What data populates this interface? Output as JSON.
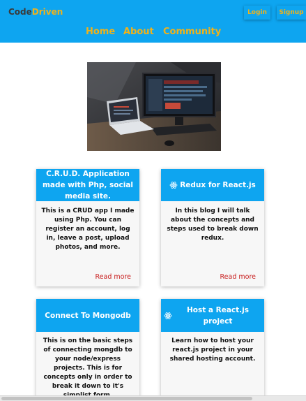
{
  "header": {
    "brand_part1": "Code",
    "brand_part2": "Driven",
    "login_label": "Login",
    "signup_label": "Signup",
    "nav": {
      "home": "Home",
      "about": "About",
      "community": "Community"
    },
    "bg_color": "#0ea5f0",
    "accent_color": "#f0b21a"
  },
  "hero_image": {
    "icon": "laptop-desk-photo"
  },
  "posts": [
    {
      "title": "C.R.U.D. Application made with Php, social media site.",
      "body": "This is a CRUD app I made using Php. You can register an account, log in, leave a post, upload photos, and more.",
      "link": "Read more"
    },
    {
      "icon": "react-icon",
      "title": "Redux for React.js",
      "body": "In this blog I will talk about the concepts and steps used to break down redux.",
      "link": "Read more"
    },
    {
      "title": "Connect To Mongodb",
      "body": "This is on the basic steps of connecting mongdb to your node/express projects. This is for concepts only in order to break it down to it's simplist form."
    },
    {
      "icon": "react-icon",
      "title": "Host a React.js project",
      "body": "Learn how to host your react.js project in your shared hosting account."
    }
  ],
  "colors": {
    "card_header": "#0ea5f0",
    "link": "#c81e1e"
  }
}
